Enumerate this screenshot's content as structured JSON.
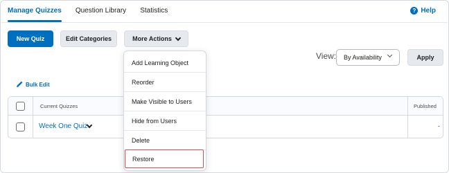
{
  "tabs": [
    {
      "label": "Manage Quizzes",
      "active": true
    },
    {
      "label": "Question Library",
      "active": false
    },
    {
      "label": "Statistics",
      "active": false
    }
  ],
  "help": {
    "icon": "help-circle-icon",
    "glyph": "?",
    "label": "Help"
  },
  "toolbar": {
    "new_quiz": "New Quiz",
    "edit_categories": "Edit Categories",
    "more_actions": "More Actions"
  },
  "view": {
    "label": "View:",
    "selected": "By Availability",
    "apply": "Apply"
  },
  "bulk_edit": {
    "label": "Bulk Edit",
    "icon": "pencil-icon"
  },
  "table": {
    "headers": {
      "name": "Current Quizzes",
      "published": "Published"
    },
    "rows": [
      {
        "name": "Week One Quiz",
        "published": "-"
      }
    ]
  },
  "menu": {
    "items": [
      "Add Learning Object",
      "Reorder",
      "Make Visible to Users",
      "Hide from Users",
      "Delete",
      "Restore"
    ],
    "highlighted": "Restore"
  },
  "colors": {
    "accent": "#006fbf",
    "highlight_border": "#c5534f"
  }
}
